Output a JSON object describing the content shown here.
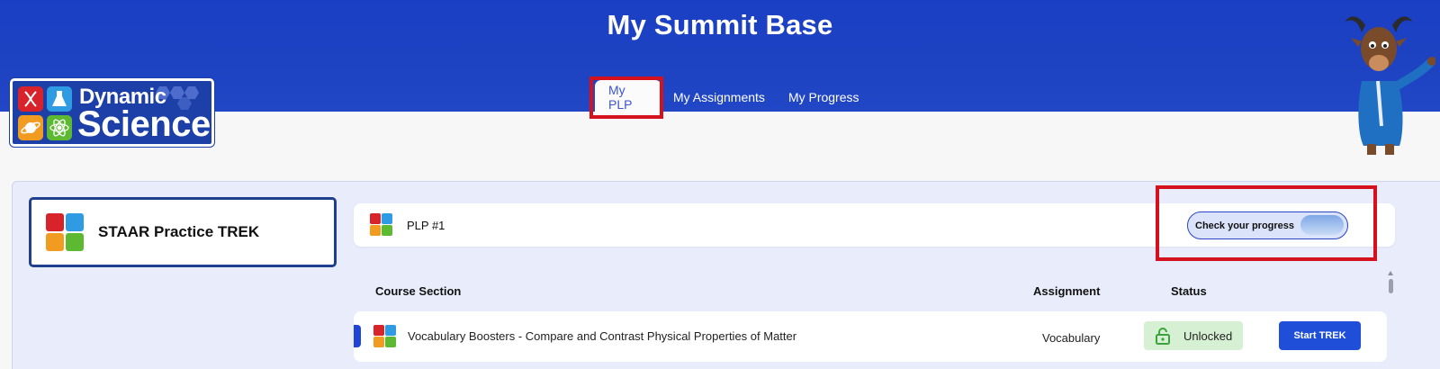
{
  "header": {
    "title": "My Summit Base",
    "tabs": [
      {
        "label": "My PLP",
        "active": true
      },
      {
        "label": "My Assignments",
        "active": false
      },
      {
        "label": "My Progress",
        "active": false
      }
    ]
  },
  "logo": {
    "line1": "Dynamic",
    "line2": "Science"
  },
  "sidebar": {
    "course_label": "STAAR Practice TREK"
  },
  "plp": {
    "label": "PLP #1",
    "progress_button": "Check your progress"
  },
  "table": {
    "columns": [
      "Course Section",
      "Assignment",
      "Status"
    ],
    "rows": [
      {
        "section": "Vocabulary Boosters - Compare and Contrast Physical Properties of Matter",
        "assignment": "Vocabulary",
        "status": "Unlocked",
        "action": "Start TREK"
      }
    ]
  },
  "colors": {
    "header_blue": "#1d43c2",
    "highlight_red": "#d4111d",
    "status_green": "#d6f0d3",
    "button_blue": "#1f4fd8"
  }
}
